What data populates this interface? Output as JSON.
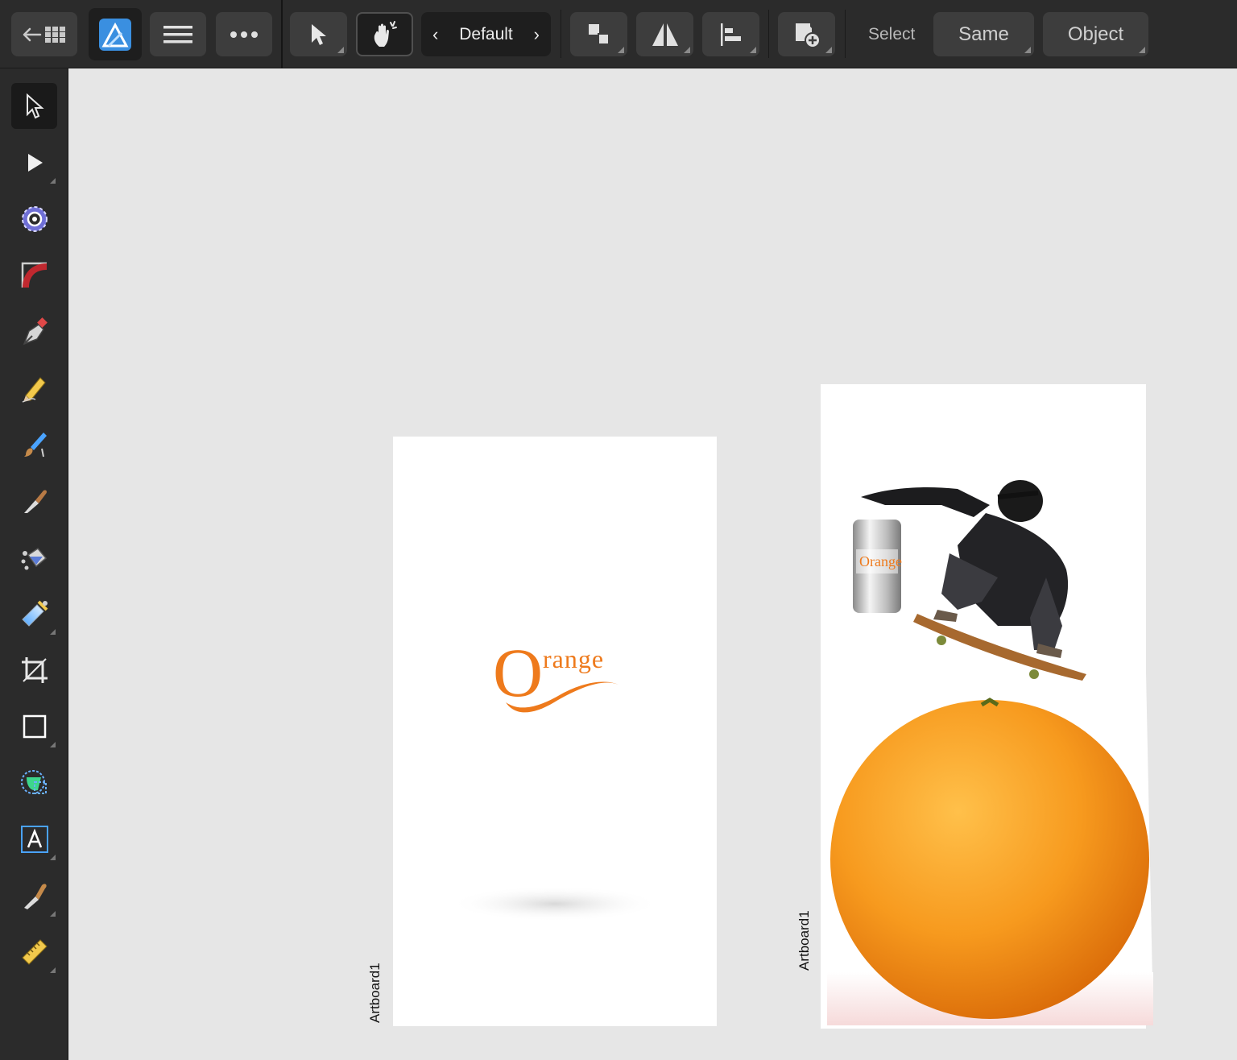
{
  "toolbar": {
    "context_default": "Default",
    "select_label": "Select",
    "same_label": "Same",
    "object_label": "Object",
    "icons": [
      "back-arrow-icon",
      "grid-icon",
      "persona-designer-icon",
      "hamburger-menu-icon",
      "more-icon",
      "move-tool-icon",
      "touch-gesture-icon",
      "arrange-icon",
      "flip-icon",
      "align-icon",
      "insert-icon"
    ]
  },
  "tools": [
    {
      "name": "move-tool",
      "icon": "pointer-arrow-icon",
      "active": true
    },
    {
      "name": "node-tool",
      "icon": "node-arrow-icon"
    },
    {
      "name": "contextual-tool",
      "icon": "target-ring-icon"
    },
    {
      "name": "corner-tool",
      "icon": "corner-curve-icon"
    },
    {
      "name": "pen-tool",
      "icon": "pen-nib-icon"
    },
    {
      "name": "pencil-tool",
      "icon": "pencil-icon"
    },
    {
      "name": "vector-brush-tool",
      "icon": "brush-icon"
    },
    {
      "name": "knife-tool",
      "icon": "knife-icon"
    },
    {
      "name": "fill-tool",
      "icon": "paint-bucket-icon"
    },
    {
      "name": "transparency-tool",
      "icon": "eraser-gradient-icon"
    },
    {
      "name": "crop-tool",
      "icon": "crop-icon"
    },
    {
      "name": "rectangle-tool",
      "icon": "rectangle-icon"
    },
    {
      "name": "shape-builder-tool",
      "icon": "shape-builder-icon"
    },
    {
      "name": "text-tool",
      "icon": "text-frame-icon"
    },
    {
      "name": "color-picker-tool",
      "icon": "eyedropper-icon"
    },
    {
      "name": "measure-tool",
      "icon": "ruler-icon"
    }
  ],
  "canvas": {
    "artboards": [
      {
        "label": "Artboard1",
        "logo_initial": "O",
        "logo_text": "range"
      },
      {
        "label": "Artboard1",
        "can_text": "Orange"
      }
    ]
  },
  "colors": {
    "toolbar_bg": "#2b2b2b",
    "canvas_bg": "#e6e6e6",
    "brand_orange": "#f07a1a",
    "persona_blue": "#3a8fe0"
  }
}
